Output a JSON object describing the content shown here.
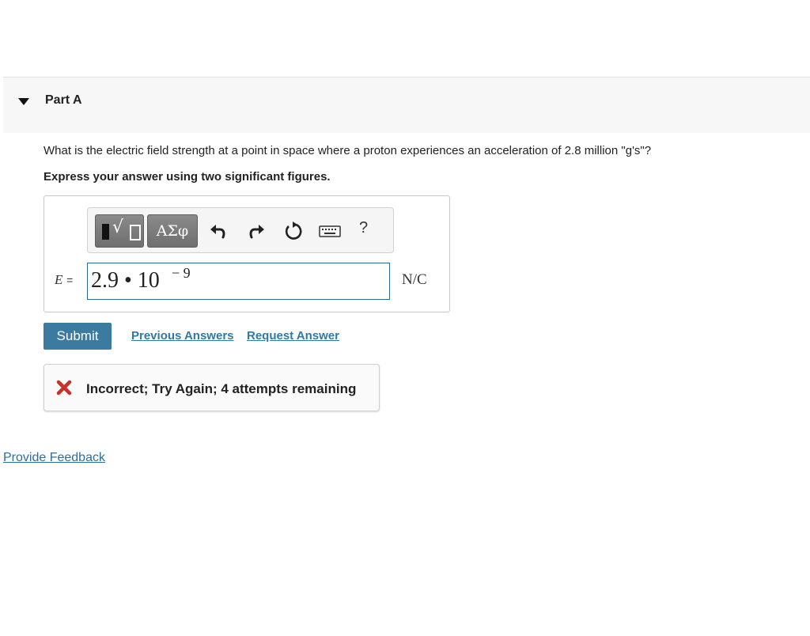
{
  "part": {
    "title": "Part A"
  },
  "question": {
    "text": "What is the electric field strength at a point in space where a proton experiences an acceleration of 2.8 million \"g's\"?",
    "instruction": "Express your answer using two significant figures."
  },
  "toolbar": {
    "templates_icon": "templates-icon",
    "greek_label": "ΑΣφ",
    "undo_icon": "undo-icon",
    "redo_icon": "redo-icon",
    "reset_icon": "reset-icon",
    "keyboard_icon": "keyboard-icon",
    "help_label": "?"
  },
  "answer": {
    "variable": "E",
    "equals": "=",
    "mantissa": "2.9 • 10",
    "exponent": "− 9",
    "units": "N/C"
  },
  "actions": {
    "submit_label": "Submit",
    "previous_answers_label": "Previous Answers",
    "request_answer_label": "Request Answer"
  },
  "feedback": {
    "status_icon": "x-icon",
    "status_color": "#c8312b",
    "message": "Incorrect; Try Again; 4 attempts remaining"
  },
  "footer": {
    "provide_feedback_label": "Provide Feedback"
  }
}
